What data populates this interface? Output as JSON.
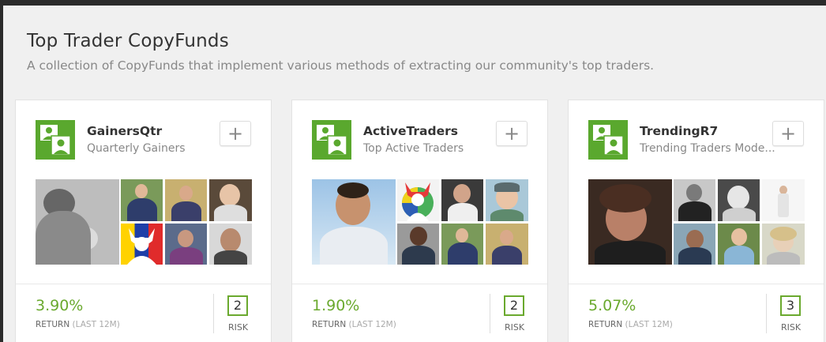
{
  "header": {
    "title": "Top Trader CopyFunds",
    "subtitle": "A collection of CopyFunds that implement various methods of extracting our community's top traders."
  },
  "brand_color": "#6aa92e",
  "cards": [
    {
      "name": "GainersQtr",
      "description": "Quarterly Gainers",
      "add_label": "+",
      "return_value": "3.90%",
      "return_label": "RETURN",
      "return_period": "(LAST 12M)",
      "risk_value": "2",
      "risk_label": "RISK"
    },
    {
      "name": "ActiveTraders",
      "description": "Top Active Traders",
      "add_label": "+",
      "return_value": "1.90%",
      "return_label": "RETURN",
      "return_period": "(LAST 12M)",
      "risk_value": "2",
      "risk_label": "RISK"
    },
    {
      "name": "TrendingR7",
      "description": "Trending Traders Mode...",
      "add_label": "+",
      "return_value": "5.07%",
      "return_label": "RETURN",
      "return_period": "(LAST 12M)",
      "risk_value": "3",
      "risk_label": "RISK"
    }
  ]
}
